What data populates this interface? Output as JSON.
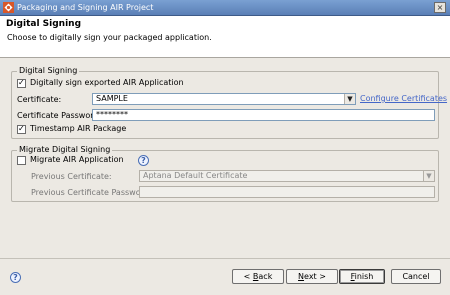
{
  "window": {
    "title": "Packaging and Signing AIR Project",
    "close_label": "×"
  },
  "header": {
    "title": "Digital Signing",
    "description": "Choose to digitally sign your packaged application."
  },
  "digital_signing": {
    "group_label": "Digital Signing",
    "sign_checkbox": {
      "label": "Digitally sign exported AIR Application",
      "checked": true
    },
    "certificate": {
      "label": "Certificate:",
      "value": "SAMPLE"
    },
    "configure_link": "Configure Certificates",
    "password": {
      "label": "Certificate Password:",
      "value": "********"
    },
    "timestamp_checkbox": {
      "label": "Timestamp AIR Package",
      "checked": true
    }
  },
  "migrate_signing": {
    "group_label": "Migrate Digital Signing",
    "migrate_checkbox": {
      "label": "Migrate AIR Application",
      "checked": false
    },
    "help_icon": "?",
    "previous_certificate": {
      "label": "Previous Certificate:",
      "value": "Aptana Default Certificate"
    },
    "previous_password": {
      "label": "Previous Certificate Password:",
      "value": ""
    }
  },
  "footer": {
    "help_icon": "?",
    "back_button": {
      "prefix": "< ",
      "mnemonic": "B",
      "rest": "ack"
    },
    "next_button": {
      "prefix": "",
      "mnemonic": "N",
      "rest": "ext >"
    },
    "finish_button": {
      "prefix": "",
      "mnemonic": "F",
      "rest": "inish"
    },
    "cancel_button": "Cancel"
  },
  "colors": {
    "link": "#4567c8",
    "titlebar": "#5a7fb6",
    "background": "#ece9e3"
  },
  "icons": [
    "app-icon",
    "close-icon",
    "help-icon",
    "dropdown-arrow-icon"
  ]
}
